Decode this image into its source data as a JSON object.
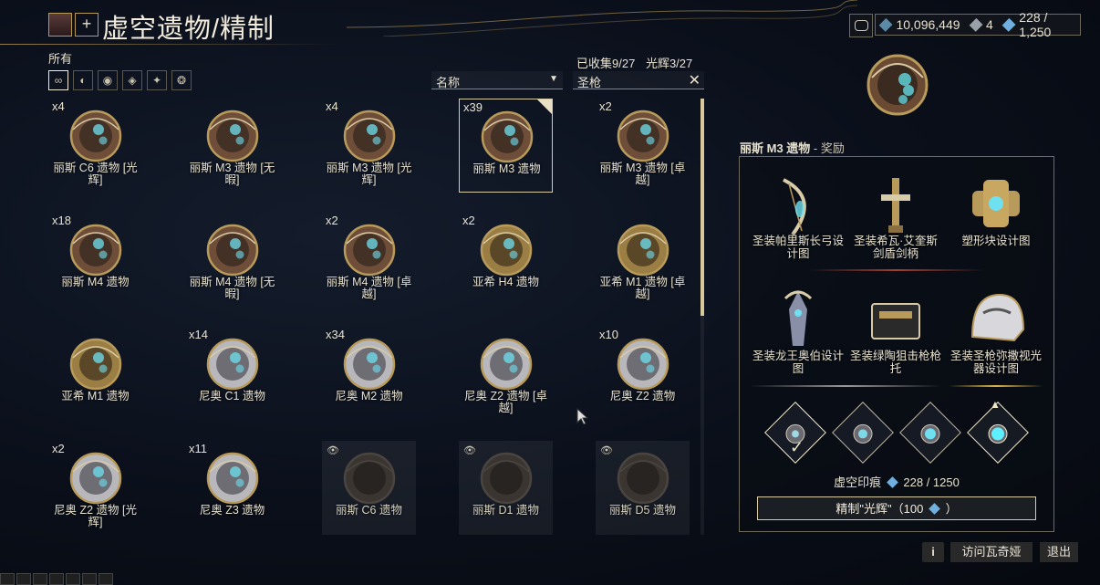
{
  "header": {
    "title": "虚空遗物/精制",
    "add_label": "+"
  },
  "currency": {
    "credits": "10,096,449",
    "plat": "4",
    "traces": "228 / 1,250"
  },
  "filter": {
    "all_label": "所有",
    "tabs": [
      {
        "glyph": "∞",
        "name": "all"
      },
      {
        "glyph": "◐",
        "name": "lith"
      },
      {
        "glyph": "◉",
        "name": "meso"
      },
      {
        "glyph": "◈",
        "name": "neo"
      },
      {
        "glyph": "✦",
        "name": "axi"
      },
      {
        "glyph": "❂",
        "name": "requiem"
      }
    ],
    "sort_label": "名称",
    "search_value": "圣枪",
    "collected": "已收集9/27",
    "radiant": "光辉3/27"
  },
  "relics": [
    {
      "count": "x4",
      "name": "丽斯 C6 遗物 [光辉]",
      "tint": "bronze",
      "locked": false
    },
    {
      "count": "",
      "name": "丽斯 M3 遗物 [无暇]",
      "tint": "bronze",
      "locked": false
    },
    {
      "count": "x4",
      "name": "丽斯 M3 遗物 [光辉]",
      "tint": "bronze",
      "locked": false
    },
    {
      "count": "x39",
      "name": "丽斯 M3 遗物",
      "tint": "bronze",
      "locked": false,
      "selected": true
    },
    {
      "count": "x2",
      "name": "丽斯 M3 遗物 [卓越]",
      "tint": "bronze",
      "locked": false
    },
    {
      "count": "x18",
      "name": "丽斯 M4 遗物",
      "tint": "bronze",
      "locked": false
    },
    {
      "count": "",
      "name": "丽斯 M4 遗物 [无暇]",
      "tint": "bronze",
      "locked": false
    },
    {
      "count": "x2",
      "name": "丽斯 M4 遗物 [卓越]",
      "tint": "bronze",
      "locked": false
    },
    {
      "count": "x2",
      "name": "亚希 H4 遗物",
      "tint": "gold",
      "locked": false
    },
    {
      "count": "",
      "name": "亚希 M1 遗物 [卓越]",
      "tint": "gold",
      "locked": false
    },
    {
      "count": "",
      "name": "亚希 M1 遗物",
      "tint": "gold",
      "locked": false
    },
    {
      "count": "x14",
      "name": "尼奥 C1 遗物",
      "tint": "silver",
      "locked": false
    },
    {
      "count": "x34",
      "name": "尼奥 M2 遗物",
      "tint": "silver",
      "locked": false
    },
    {
      "count": "",
      "name": "尼奥 Z2 遗物 [卓越]",
      "tint": "silver",
      "locked": false
    },
    {
      "count": "x10",
      "name": "尼奥 Z2 遗物",
      "tint": "silver",
      "locked": false
    },
    {
      "count": "x2",
      "name": "尼奥 Z2 遗物 [光辉]",
      "tint": "silver",
      "locked": false
    },
    {
      "count": "x11",
      "name": "尼奥 Z3 遗物",
      "tint": "silver",
      "locked": false
    },
    {
      "count": "",
      "name": "丽斯 C6 遗物",
      "tint": "dark",
      "locked": true
    },
    {
      "count": "",
      "name": "丽斯 D1 遗物",
      "tint": "dark",
      "locked": true
    },
    {
      "count": "",
      "name": "丽斯 D5 遗物",
      "tint": "dark",
      "locked": true
    }
  ],
  "panel": {
    "relic_name": "丽斯 M3 遗物",
    "reward_suffix": " - 奖励",
    "rewards": [
      {
        "name": "圣装帕里斯长弓设计图",
        "icon": "bow-icon"
      },
      {
        "name": "圣装希瓦·艾奎斯剑盾剑柄",
        "icon": "hilt-icon"
      },
      {
        "name": "塑形块设计图",
        "icon": "forma-icon"
      },
      {
        "name": "圣装龙王奥伯设计图",
        "icon": "oberon-icon"
      },
      {
        "name": "圣装绿陶狙击枪枪托",
        "icon": "stock-icon"
      },
      {
        "name": "圣装圣枪弥撒视光器设计图",
        "icon": "helmet-icon"
      }
    ],
    "traces_label": "虚空印痕",
    "traces_value": "228 / 1250",
    "refine_label": "精制\"光辉\"（100",
    "refine_suffix": "）"
  },
  "footer": {
    "info_label": "i",
    "visit_label": "访问瓦奇娅",
    "exit_label": "退出"
  },
  "colors": {
    "gold_accent": "#b89a5a",
    "bronze": "#7a5a40",
    "gold": "#b8a060",
    "silver": "#c8c8c8"
  }
}
